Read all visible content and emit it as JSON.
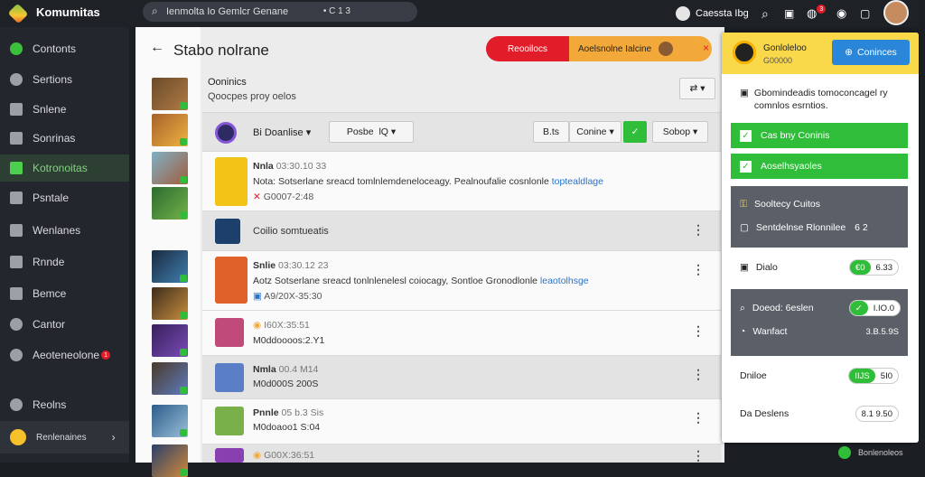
{
  "app": {
    "brand": "Komumitas"
  },
  "search": {
    "placeholder": "Ienmolta Io Gemlcr Genane",
    "shortcut": "• C 1 3"
  },
  "topbar": {
    "link": "Caessta Ibg",
    "notif_count": "3"
  },
  "sidebar": {
    "items": [
      {
        "label": "Contonts",
        "icon": "globe-icon"
      },
      {
        "label": "Sertions",
        "icon": "gear-icon"
      },
      {
        "label": "Snlene",
        "icon": "book-icon"
      },
      {
        "label": "Sonrinas",
        "icon": "grid-icon"
      },
      {
        "label": "Kotronoitas",
        "icon": "box-icon"
      },
      {
        "label": "Psntale",
        "icon": "folder-icon"
      },
      {
        "label": "Wenlanes",
        "icon": "chart-icon"
      },
      {
        "label": "Rnnde",
        "icon": "doc-icon"
      },
      {
        "label": "Bemce",
        "icon": "file-icon"
      },
      {
        "label": "Cantor",
        "icon": "eye-icon"
      },
      {
        "label": "Aeoteneolone",
        "icon": "shield-icon",
        "badge": "1"
      }
    ],
    "bottom": [
      {
        "label": "Reolns",
        "icon": "settings-icon"
      },
      {
        "label": "Renlenaines",
        "icon": "user-icon"
      }
    ]
  },
  "page": {
    "title": "Stabo nolrane",
    "subtitle": "Ooninics",
    "meta": "Qoocpes proy oelos",
    "alert_red": "Reooilocs",
    "alert_orange": "Aoelsnolne Ialcine"
  },
  "toolbar": {
    "filter_label": "Bi Doanlise",
    "sort_label": "Posbe",
    "sort_value": "lQ",
    "btn1": "B.ts",
    "btn2": "Conine",
    "btn3": "Sobop"
  },
  "posts": [
    {
      "name": "Nnla",
      "time": "03:30.10 33",
      "text": "Nota: Sotserlane sreacd tomlnlemdeneloceagy. Pealnoufalie cosnlonle",
      "link": "toptealdlage",
      "date": "G0007-2:48"
    },
    {
      "name": "",
      "time": "",
      "text": "Coilio somtueatis",
      "link": "",
      "date": ""
    },
    {
      "name": "Snlie",
      "time": "03:30.12 23",
      "text": "Aotz Sotserlane sreacd tonlnlenelesl coiocagy, Sontloe Gronodlonle",
      "link": "leaotolhsge",
      "date": "A9/20X-35:30"
    },
    {
      "name": "",
      "time": "I60X:35:51",
      "text": "M0ddoooos:2.Y1",
      "link": "",
      "date": ""
    },
    {
      "name": "Nmla",
      "time": "00.4 M14",
      "text": "M0d000S 200S",
      "link": "",
      "date": ""
    },
    {
      "name": "Pnnle",
      "time": "05 b.3 Sis",
      "text": "M0doaoo1 S:04",
      "link": "",
      "date": ""
    },
    {
      "name": "",
      "time": "G00X:36:51",
      "text": "",
      "link": "",
      "date": ""
    }
  ],
  "right": {
    "head_title": "Gonloleloo",
    "head_sub": "G00000",
    "head_button": "Coninces",
    "info": "Gbomindeadis tomoconcagel ry comnlos esrntios.",
    "check1": "Cas bny Coninis",
    "check2": "Aoselhsyaoles",
    "dark1": "Sooltecy Cuitos",
    "dark2": "Sentdelnse Rlonnilee",
    "dark2_val": "6 2",
    "row1_label": "Dialo",
    "row1_pill_green": "€0",
    "row1_pill_val": "6.33",
    "dark3_label": "Doeod: 6eslen",
    "dark3_pill": "I.IO.0",
    "dark4_label": "Wanfact",
    "dark4_val": "3.B.5.9S",
    "row2_label": "Dniloe",
    "row2_green": "IIJS",
    "row2_val": "5I0",
    "row3_label": "Da Deslens",
    "row3_val": "8.1 9.50"
  },
  "footer": {
    "text": "Bonlenoleos"
  },
  "colors": {
    "accent": "#2fbd3a",
    "alert": "#e21d2a",
    "warning": "#f3a93a",
    "sidebar": "#23272d"
  }
}
